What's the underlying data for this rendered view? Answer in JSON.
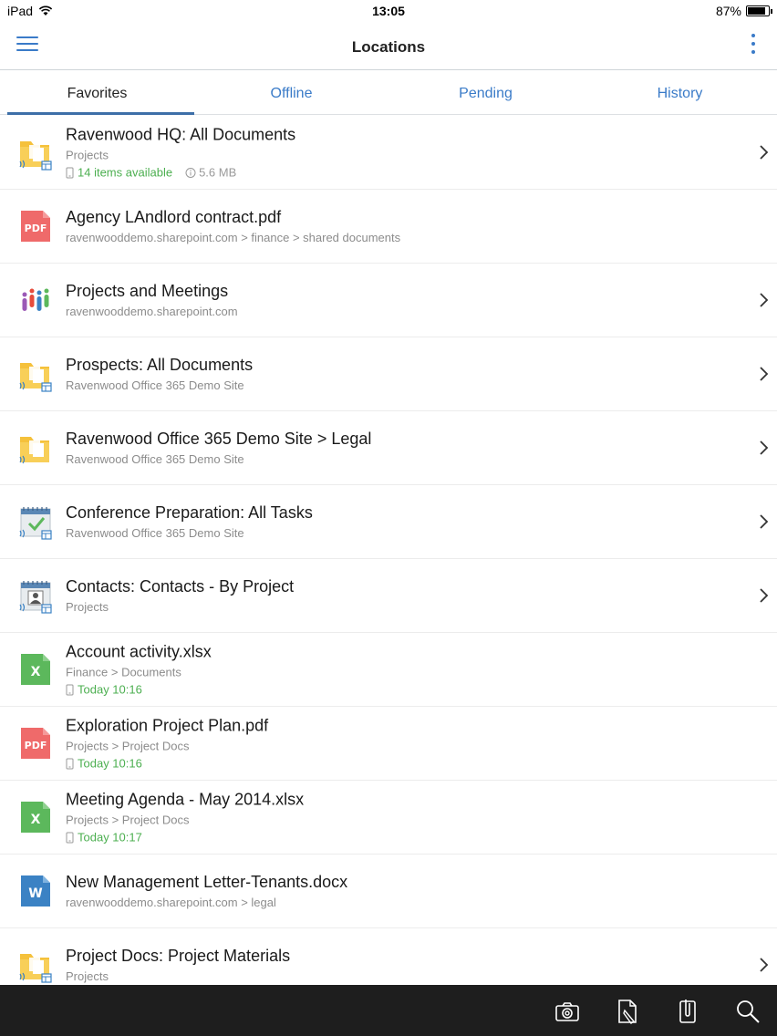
{
  "status_bar": {
    "device": "iPad",
    "time": "13:05",
    "battery": "87%",
    "battery_level": 0.87
  },
  "navbar": {
    "title": "Locations",
    "accent_color": "#3a7bc8"
  },
  "tabs": [
    {
      "label": "Favorites",
      "active": true
    },
    {
      "label": "Offline",
      "active": false
    },
    {
      "label": "Pending",
      "active": false
    },
    {
      "label": "History",
      "active": false
    }
  ],
  "items": [
    {
      "icon": "folder-list-icon",
      "name": "Ravenwood HQ: All Documents",
      "sub": "Projects",
      "meta": "14 items available",
      "meta_extra": "5.6 MB",
      "chevron": true
    },
    {
      "icon": "pdf-file-icon",
      "name": "Agency LAndlord contract.pdf",
      "sub": "ravenwooddemo.sharepoint.com > finance > shared documents",
      "chevron": false
    },
    {
      "icon": "site-people-icon",
      "name": "Projects and Meetings",
      "sub": "ravenwooddemo.sharepoint.com",
      "chevron": true
    },
    {
      "icon": "folder-list-icon",
      "name": "Prospects: All Documents",
      "sub": "Ravenwood Office 365 Demo Site",
      "chevron": true
    },
    {
      "icon": "folder-icon",
      "name": "Ravenwood Office 365 Demo Site > Legal",
      "sub": "Ravenwood Office 365 Demo Site",
      "chevron": true
    },
    {
      "icon": "tasks-calendar-icon",
      "name": "Conference Preparation: All Tasks",
      "sub": "Ravenwood Office 365 Demo Site",
      "chevron": true
    },
    {
      "icon": "contacts-calendar-icon",
      "name": "Contacts: Contacts - By Project",
      "sub": "Projects",
      "chevron": true
    },
    {
      "icon": "excel-file-icon",
      "name": "Account activity.xlsx",
      "sub": "Finance > Documents",
      "meta": "Today 10:16",
      "chevron": false
    },
    {
      "icon": "pdf-file-icon",
      "name": "Exploration Project Plan.pdf",
      "sub": "Projects > Project Docs",
      "meta": "Today 10:16",
      "chevron": false
    },
    {
      "icon": "excel-file-icon",
      "name": "Meeting Agenda - May 2014.xlsx",
      "sub": "Projects > Project Docs",
      "meta": "Today 10:17",
      "chevron": false
    },
    {
      "icon": "word-file-icon",
      "name": "New Management Letter-Tenants.docx",
      "sub": "ravenwooddemo.sharepoint.com > legal",
      "chevron": false
    },
    {
      "icon": "folder-list-icon",
      "name": "Project Docs: Project Materials",
      "sub": "Projects",
      "chevron": true
    }
  ],
  "toolbar": {
    "buttons": [
      "camera-icon",
      "edit-document-icon",
      "attachment-icon",
      "search-icon"
    ]
  },
  "colors": {
    "folder": "#f5c13b",
    "pdf": "#ef6a6a",
    "excel": "#5cb85c",
    "word": "#3b82c4",
    "available_green": "#4caf50"
  }
}
